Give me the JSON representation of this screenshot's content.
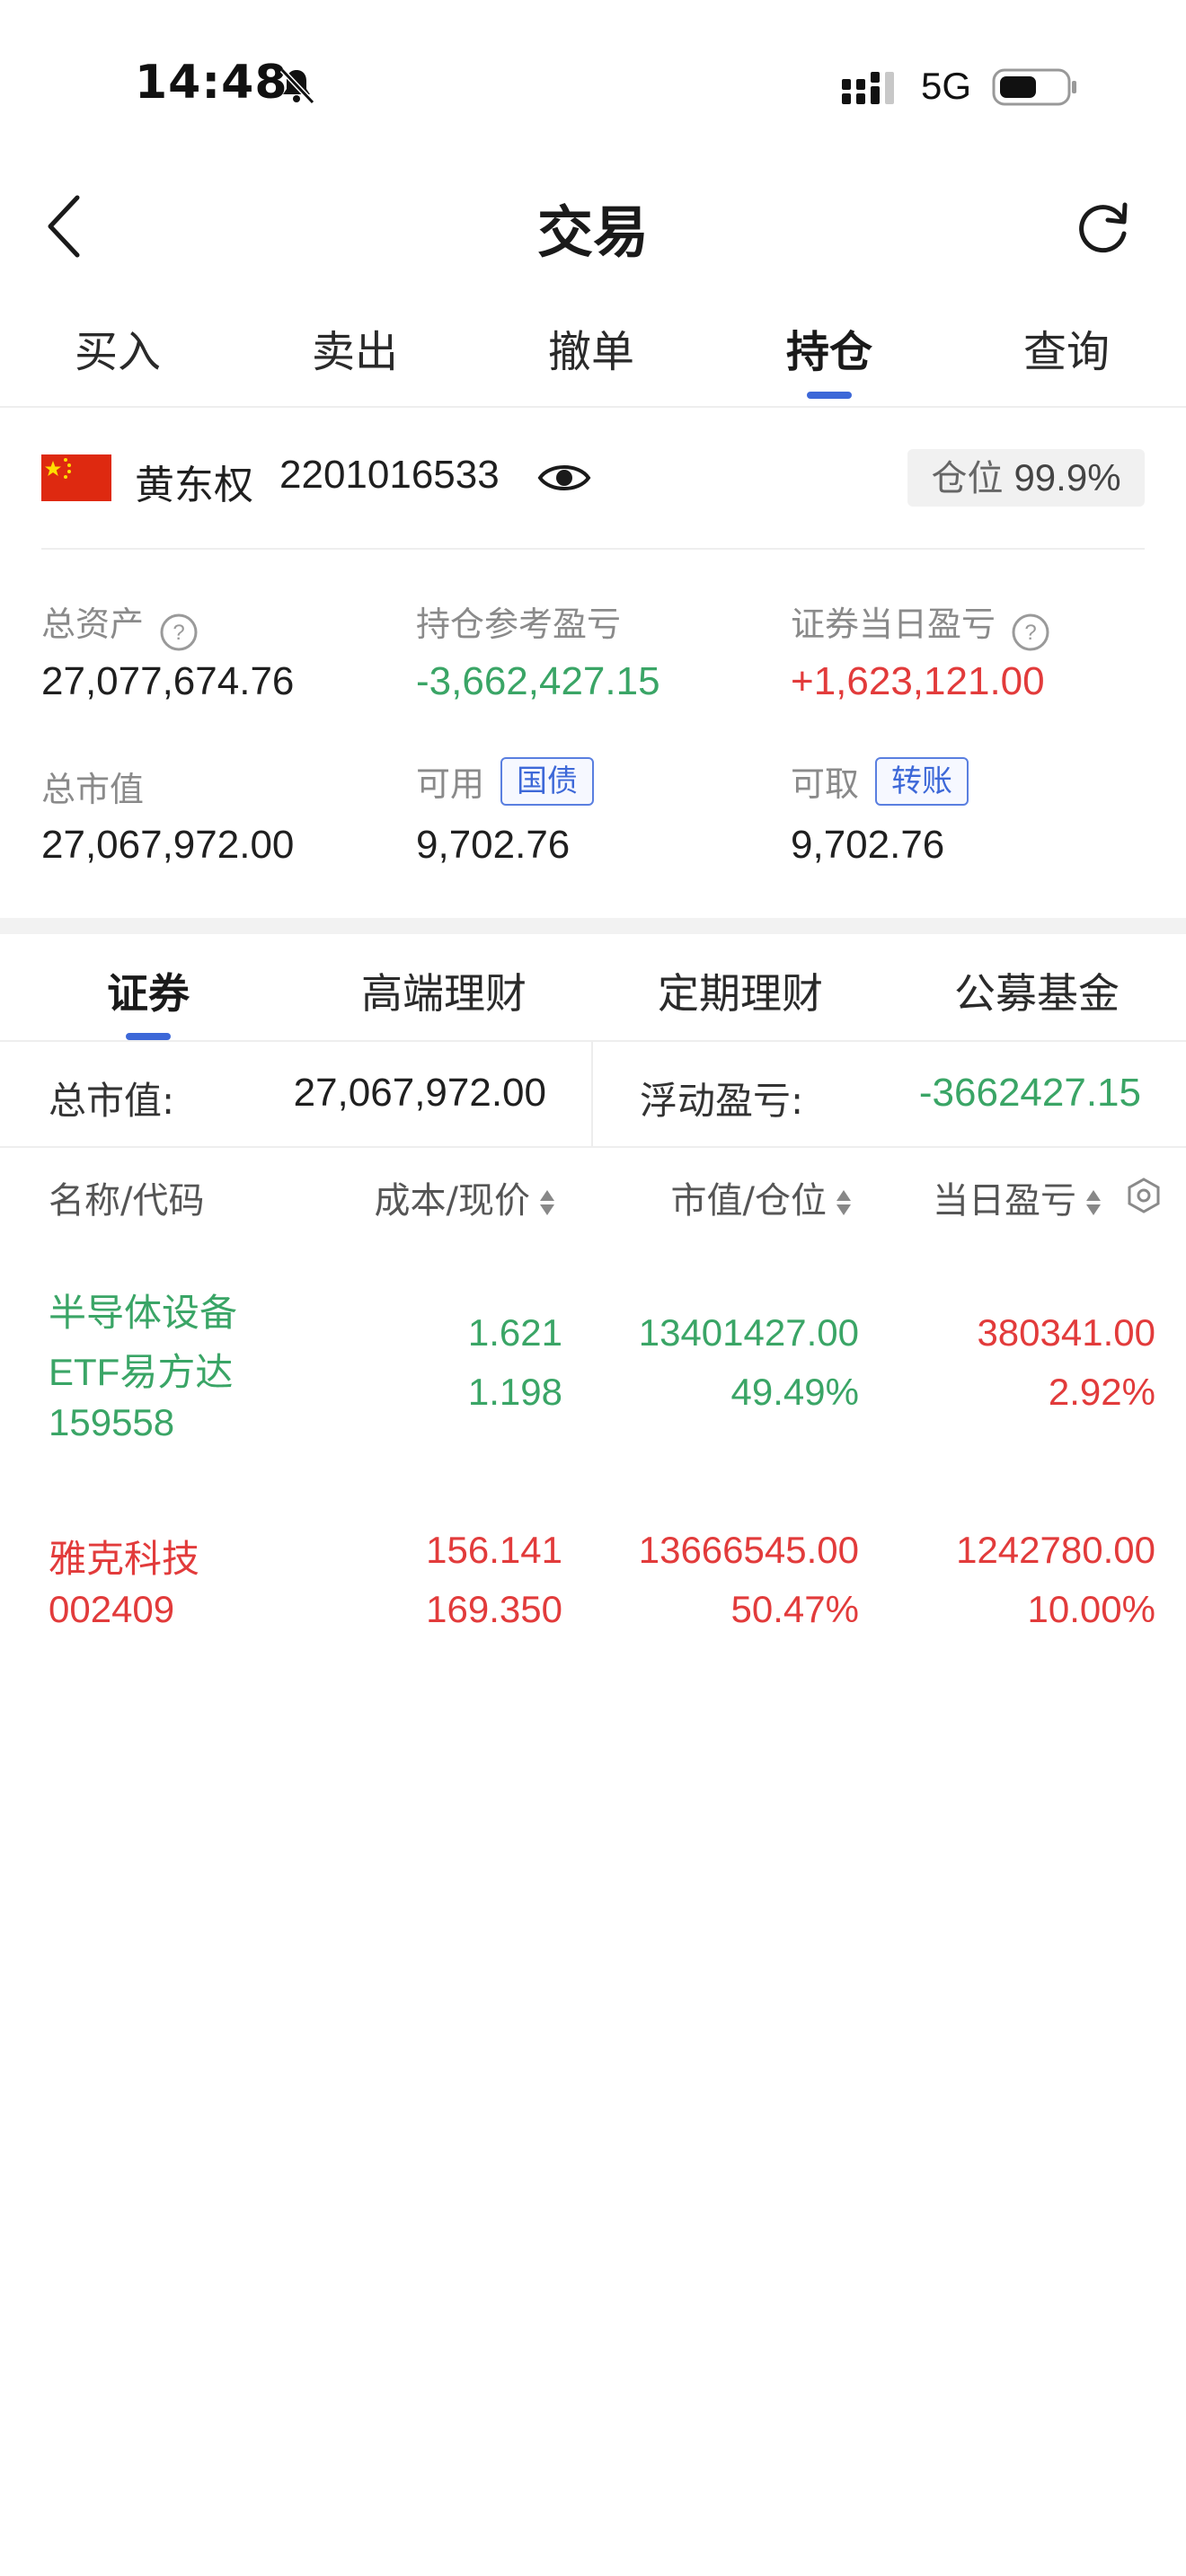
{
  "status_bar": {
    "time": "14:48",
    "network": "5G"
  },
  "header": {
    "title": "交易"
  },
  "top_tabs": [
    {
      "label": "买入"
    },
    {
      "label": "卖出"
    },
    {
      "label": "撤单"
    },
    {
      "label": "持仓",
      "active": true
    },
    {
      "label": "查询"
    }
  ],
  "account": {
    "name": "黄东权",
    "number": "2201016533",
    "position_label": "仓位",
    "position_value": "99.9%"
  },
  "summary": {
    "total_assets_label": "总资产",
    "total_assets": "27,077,674.76",
    "hold_pnl_label": "持仓参考盈亏",
    "hold_pnl": "-3,662,427.15",
    "day_pnl_label": "证券当日盈亏",
    "day_pnl": "+1,623,121.00",
    "market_value_label": "总市值",
    "market_value": "27,067,972.00",
    "available_label": "可用",
    "available_tag": "国债",
    "available": "9,702.76",
    "withdrawable_label": "可取",
    "withdrawable_tag": "转账",
    "withdrawable": "9,702.76"
  },
  "sub_tabs": [
    {
      "label": "证券",
      "active": true
    },
    {
      "label": "高端理财"
    },
    {
      "label": "定期理财"
    },
    {
      "label": "公募基金"
    }
  ],
  "totals": {
    "market_value_label": "总市值:",
    "market_value": "27,067,972.00",
    "floating_pnl_label": "浮动盈亏:",
    "floating_pnl": "-3662427.15"
  },
  "columns": {
    "name_code": "名称/代码",
    "cost_price": "成本/现价",
    "value_position": "市值/仓位",
    "day_pnl": "当日盈亏"
  },
  "holdings": [
    {
      "name_line1": "半导体设备",
      "name_line2": "ETF易方达",
      "code": "159558",
      "cost": "1.621",
      "price": "1.198",
      "market_value": "13401427.00",
      "position": "49.49%",
      "day_pnl": "380341.00",
      "day_pnl_pct": "2.92%"
    },
    {
      "name_line1": "雅克科技",
      "code": "002409",
      "cost": "156.141",
      "price": "169.350",
      "market_value": "13666545.00",
      "position": "50.47%",
      "day_pnl": "1242780.00",
      "day_pnl_pct": "10.00%"
    }
  ],
  "colors": {
    "accent": "#3d68d8",
    "gain": "#e23b3b",
    "loss": "#3aa566"
  }
}
